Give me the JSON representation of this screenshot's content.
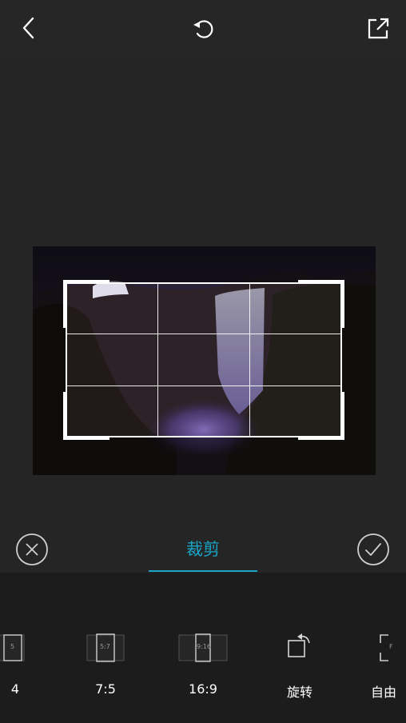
{
  "toolbar": {
    "back_icon": "chevron-left-icon",
    "reset_icon": "rotate-ccw-icon",
    "share_icon": "share-external-icon"
  },
  "editor": {
    "accent_color": "#19a5c8"
  },
  "tabs": {
    "active_label": "裁剪",
    "cancel_icon": "close-circle-icon",
    "confirm_icon": "check-circle-icon"
  },
  "ratios": {
    "items": [
      {
        "label": "4",
        "icon_text": "5"
      },
      {
        "label": "7:5",
        "icon_text": "5:7"
      },
      {
        "label": "16:9",
        "icon_text": "9:16"
      },
      {
        "label": "旋转",
        "icon_text": ""
      },
      {
        "label": "自由",
        "icon_text": "F"
      }
    ]
  }
}
